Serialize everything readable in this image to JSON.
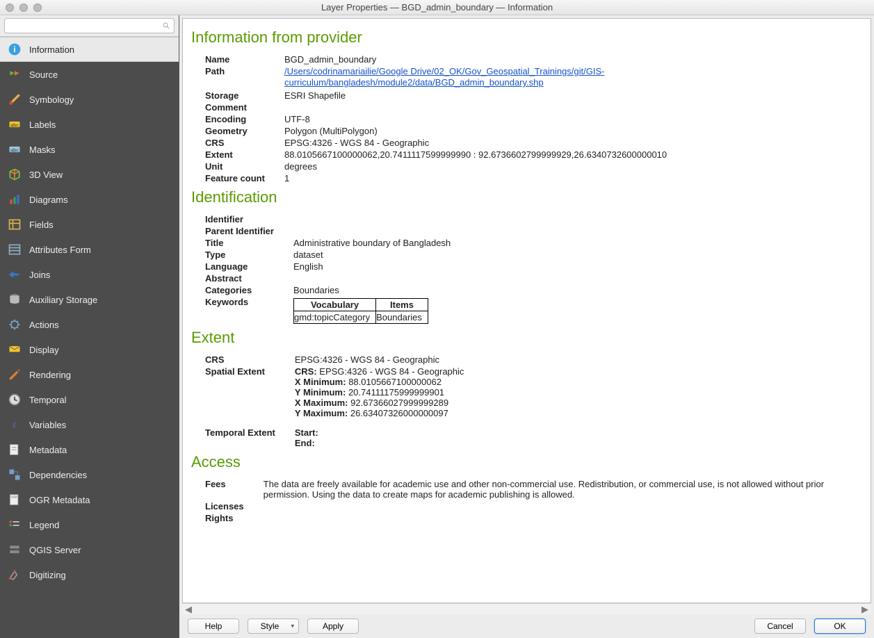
{
  "window": {
    "title": "Layer Properties — BGD_admin_boundary — Information"
  },
  "search": {
    "placeholder": ""
  },
  "sidebar": {
    "items": [
      {
        "label": "Information",
        "active": true,
        "icon": "info"
      },
      {
        "label": "Source",
        "icon": "source"
      },
      {
        "label": "Symbology",
        "icon": "symbology"
      },
      {
        "label": "Labels",
        "icon": "labels"
      },
      {
        "label": "Masks",
        "icon": "masks"
      },
      {
        "label": "3D View",
        "icon": "3d"
      },
      {
        "label": "Diagrams",
        "icon": "diagrams"
      },
      {
        "label": "Fields",
        "icon": "fields"
      },
      {
        "label": "Attributes Form",
        "icon": "attrform"
      },
      {
        "label": "Joins",
        "icon": "joins"
      },
      {
        "label": "Auxiliary Storage",
        "icon": "auxstorage"
      },
      {
        "label": "Actions",
        "icon": "actions"
      },
      {
        "label": "Display",
        "icon": "display"
      },
      {
        "label": "Rendering",
        "icon": "rendering"
      },
      {
        "label": "Temporal",
        "icon": "temporal"
      },
      {
        "label": "Variables",
        "icon": "variables"
      },
      {
        "label": "Metadata",
        "icon": "metadata"
      },
      {
        "label": "Dependencies",
        "icon": "deps"
      },
      {
        "label": "OGR Metadata",
        "icon": "ogr"
      },
      {
        "label": "Legend",
        "icon": "legend"
      },
      {
        "label": "QGIS Server",
        "icon": "server"
      },
      {
        "label": "Digitizing",
        "icon": "digitizing"
      }
    ]
  },
  "sections": {
    "provider": {
      "heading": "Information from provider",
      "name_label": "Name",
      "name": "BGD_admin_boundary",
      "path_label": "Path",
      "path": "/Users/codrinamariailie/Google Drive/02_OK/Gov_Geospatial_Trainings/git/GIS-curriculum/bangladesh/module2/data/BGD_admin_boundary.shp",
      "storage_label": "Storage",
      "storage": "ESRI Shapefile",
      "comment_label": "Comment",
      "comment": "",
      "encoding_label": "Encoding",
      "encoding": "UTF-8",
      "geometry_label": "Geometry",
      "geometry": "Polygon (MultiPolygon)",
      "crs_label": "CRS",
      "crs": "EPSG:4326 - WGS 84 - Geographic",
      "extent_label": "Extent",
      "extent": "88.0105667100000062,20.7411117599999990 : 92.6736602799999929,26.6340732600000010",
      "unit_label": "Unit",
      "unit": "degrees",
      "fcount_label": "Feature count",
      "fcount": "1"
    },
    "identification": {
      "heading": "Identification",
      "identifier_label": "Identifier",
      "identifier": "",
      "parent_label": "Parent Identifier",
      "parent": "",
      "title_label": "Title",
      "title": "Administrative boundary of Bangladesh",
      "type_label": "Type",
      "type": "dataset",
      "language_label": "Language",
      "language": "English",
      "abstract_label": "Abstract",
      "abstract": "",
      "categories_label": "Categories",
      "categories": "Boundaries",
      "keywords_label": "Keywords",
      "kw_header_vocab": "Vocabulary",
      "kw_header_items": "Items",
      "kw_vocab": "gmd:topicCategory",
      "kw_items": "Boundaries"
    },
    "extent": {
      "heading": "Extent",
      "crs_label": "CRS",
      "crs": "EPSG:4326 - WGS 84 - Geographic",
      "spatial_label": "Spatial Extent",
      "sp_crs_label": "CRS:",
      "sp_crs": "EPSG:4326 - WGS 84 - Geographic",
      "sp_xmin_label": "X Minimum:",
      "sp_xmin": "88.0105667100000062",
      "sp_ymin_label": "Y Minimum:",
      "sp_ymin": "20.74111175999999901",
      "sp_xmax_label": "X Maximum:",
      "sp_xmax": "92.67366027999999289",
      "sp_ymax_label": "Y Maximum:",
      "sp_ymax": "26.63407326000000097",
      "temporal_label": "Temporal Extent",
      "t_start_label": "Start:",
      "t_start": "",
      "t_end_label": "End:",
      "t_end": ""
    },
    "access": {
      "heading": "Access",
      "fees_label": "Fees",
      "fees": "The data are freely available for academic use and other non-commercial use. Redistribution, or commercial use, is not allowed without prior permission. Using the data to create maps for academic publishing is allowed.",
      "licenses_label": "Licenses",
      "licenses": "",
      "rights_label": "Rights",
      "rights": ""
    }
  },
  "footer": {
    "help": "Help",
    "style": "Style",
    "apply": "Apply",
    "cancel": "Cancel",
    "ok": "OK"
  }
}
